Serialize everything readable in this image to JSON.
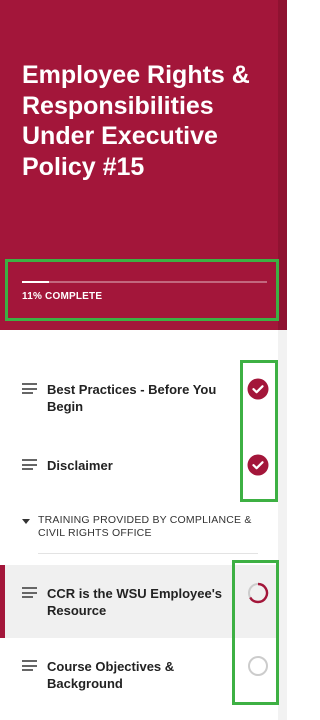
{
  "course": {
    "title": "Employee Rights & Responsibilities Under Executive Policy #15",
    "progress_percent": 11,
    "progress_label": "11% COMPLETE"
  },
  "lessons_before": [
    {
      "label": "Best Practices - Before You Begin",
      "status": "complete",
      "status_icon": "check-circle-icon"
    },
    {
      "label": "Disclaimer",
      "status": "complete",
      "status_icon": "check-circle-icon"
    }
  ],
  "section": {
    "title": "TRAINING PROVIDED BY COMPLIANCE & CIVIL RIGHTS OFFICE",
    "icon": "caret-down-icon"
  },
  "lessons_section": [
    {
      "label": "CCR is the WSU Employee's Resource",
      "status": "in-progress",
      "status_icon": "progress-ring-icon",
      "active": true
    },
    {
      "label": "Course Objectives & Background",
      "status": "not-started",
      "status_icon": "empty-ring-icon",
      "active": false
    }
  ],
  "colors": {
    "brand": "#a3163a",
    "highlight": "#3db043",
    "complete": "#a3163a",
    "incomplete": "#cccccc"
  }
}
